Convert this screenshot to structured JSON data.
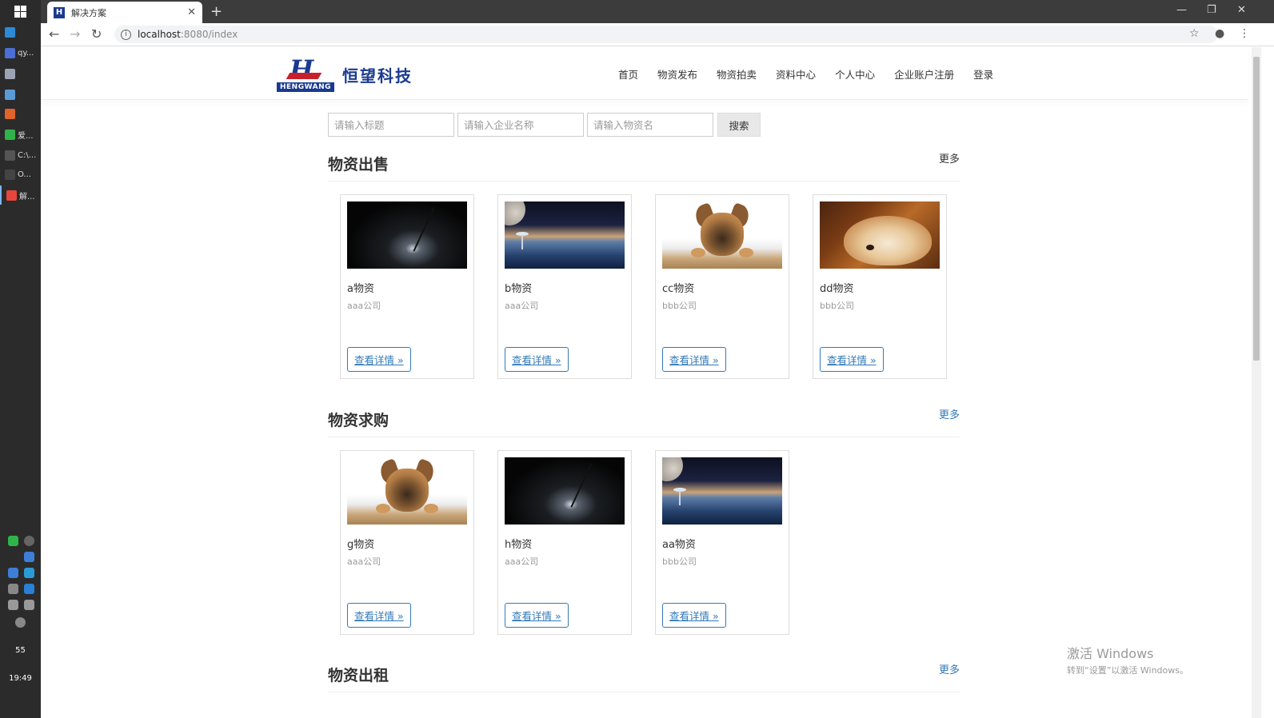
{
  "taskbar": {
    "items": [
      {
        "label": "qy...",
        "color": "#4a6fd6"
      },
      {
        "label": "",
        "color": "#9aa4b4"
      },
      {
        "label": "",
        "color": "#5b9bd5"
      },
      {
        "label": "",
        "color": "#e0632a"
      },
      {
        "label": "爱...",
        "color": "#2fb44a"
      },
      {
        "label": "C:\\...",
        "color": "#555555"
      },
      {
        "label": "O...",
        "color": "#444444"
      },
      {
        "label": "解...",
        "color": "#e8453c"
      }
    ],
    "tray_number": "55",
    "clock": "19:49"
  },
  "browser": {
    "tab_title": "解决方案",
    "tab_favicon": "H",
    "new_tab": "+",
    "url_host": "localhost",
    "url_path": ":8080/index"
  },
  "site": {
    "logo_en": "HENGWANG",
    "logo_mark": "H",
    "logo_cn": "恒望科技",
    "nav": [
      "首页",
      "物资发布",
      "物资拍卖",
      "资料中心",
      "个人中心",
      "企业账户注册",
      "登录"
    ]
  },
  "search": {
    "title_placeholder": "请输入标题",
    "company_placeholder": "请输入企业名称",
    "material_placeholder": "请输入物资名",
    "button": "搜索"
  },
  "sections": [
    {
      "title": "物资出售",
      "more": "更多",
      "cards": [
        {
          "name": "a物资",
          "company": "aaa公司",
          "button": "查看详情 »",
          "image": "night-landscape"
        },
        {
          "name": "b物资",
          "company": "aaa公司",
          "button": "查看详情 »",
          "image": "space-planet"
        },
        {
          "name": "cc物资",
          "company": "bbb公司",
          "button": "查看详情 »",
          "image": "puppy-on-bed"
        },
        {
          "name": "dd物资",
          "company": "bbb公司",
          "button": "查看详情 »",
          "image": "sleeping-puppy"
        }
      ]
    },
    {
      "title": "物资求购",
      "more": "更多",
      "cards": [
        {
          "name": "g物资",
          "company": "aaa公司",
          "button": "查看详情 »",
          "image": "puppy-on-bed"
        },
        {
          "name": "h物资",
          "company": "aaa公司",
          "button": "查看详情 »",
          "image": "night-landscape"
        },
        {
          "name": "aa物资",
          "company": "bbb公司",
          "button": "查看详情 »",
          "image": "space-planet"
        }
      ]
    },
    {
      "title": "物资出租",
      "more": "更多",
      "cards": []
    }
  ],
  "watermark": {
    "line1": "激活 Windows",
    "line2": "转到“设置”以激活 Windows。"
  },
  "colors": {
    "brand_blue": "#1a3a8f",
    "brand_red": "#c8202b",
    "link_blue": "#337ab7"
  }
}
